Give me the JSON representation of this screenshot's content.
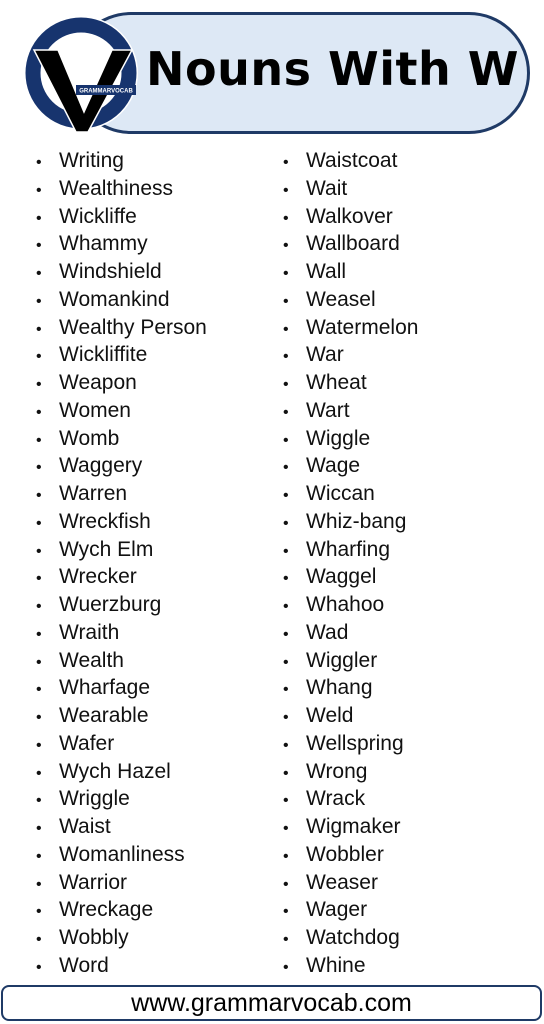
{
  "header": {
    "title": "Nouns With W",
    "logo_text": "GRAMMARVOCAB",
    "colors": {
      "navy": "#1f3a66",
      "pill_fill": "#dde8f5",
      "logo_blue": "#17346e"
    }
  },
  "list": {
    "bullet": "•",
    "left": [
      "Writing",
      "Wealthiness",
      "Wickliffe",
      "Whammy",
      "Windshield",
      "Womankind",
      "Wealthy Person",
      "Wickliffite",
      "Weapon",
      "Women",
      "Womb",
      "Waggery",
      "Warren",
      "Wreckfish",
      "Wych Elm",
      "Wrecker",
      "Wuerzburg",
      "Wraith",
      "Wealth",
      "Wharfage",
      "Wearable",
      "Wafer",
      "Wych Hazel",
      "Wriggle",
      "Waist",
      "Womanliness",
      "Warrior",
      "Wreckage",
      "Wobbly",
      "Word"
    ],
    "right": [
      "Waistcoat",
      "Wait",
      "Walkover",
      "Wallboard",
      "Wall",
      "Weasel",
      "Watermelon",
      "War",
      "Wheat",
      "Wart",
      "Wiggle",
      "Wage",
      "Wiccan",
      "Whiz-bang",
      "Wharfing",
      "Waggel",
      "Whahoo",
      "Wad",
      "Wiggler",
      "Whang",
      "Weld",
      "Wellspring",
      "Wrong",
      "Wrack",
      "Wigmaker",
      "Wobbler",
      "Weaser",
      "Wager",
      "Watchdog",
      "Whine"
    ]
  },
  "footer": {
    "url": "www.grammarvocab.com"
  }
}
